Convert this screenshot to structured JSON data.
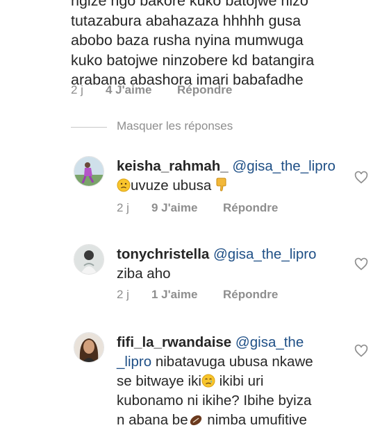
{
  "parent_comment": {
    "lines": [
      "ngize ngo bakore kuko batojwe nizo",
      "tutazabura abahazaza hhhhh gusa",
      "abobo baza rusha nyina mumwuga",
      "kuko batojwe ninzobere kd batangira",
      "arabana abashora imari babafadhe"
    ],
    "time": "2 j",
    "likes": "4 J'aime",
    "reply": "Répondre"
  },
  "hide_replies_label": "Masquer les réponses",
  "replies": [
    {
      "username": "keisha_rahmah_",
      "mention": "@gisa_the_lipro",
      "text": "uvuze ubusa",
      "time": "2 j",
      "likes": "9 J'aime",
      "reply": "Répondre"
    },
    {
      "username": "tonychristella",
      "mention": "@gisa_the_lipro",
      "text": "ziba aho",
      "time": "2 j",
      "likes": "1 J'aime",
      "reply": "Répondre"
    },
    {
      "username": "fifi_la_rwandaise",
      "mention_part1": "@gisa_the",
      "mention_part2": "_lipro",
      "line2_text": " nibatavuga ubusa nkawe",
      "line3_text": "se bitwaye iki",
      "line3_after": " ikibi uri",
      "line4_text": "kubonamo ni ikihe? Ibihe byiza",
      "line5_text": "n abana be",
      "line5_after": " nimba umufitive"
    }
  ],
  "colors": {
    "text": "#262626",
    "secondary": "#8e8e8e",
    "mention": "#1e4f86"
  },
  "icons": [
    "heart-outline-icon",
    "frowning-face-emoji",
    "thumbs-down-emoji",
    "crying-face-emoji",
    "ball-emoji"
  ]
}
